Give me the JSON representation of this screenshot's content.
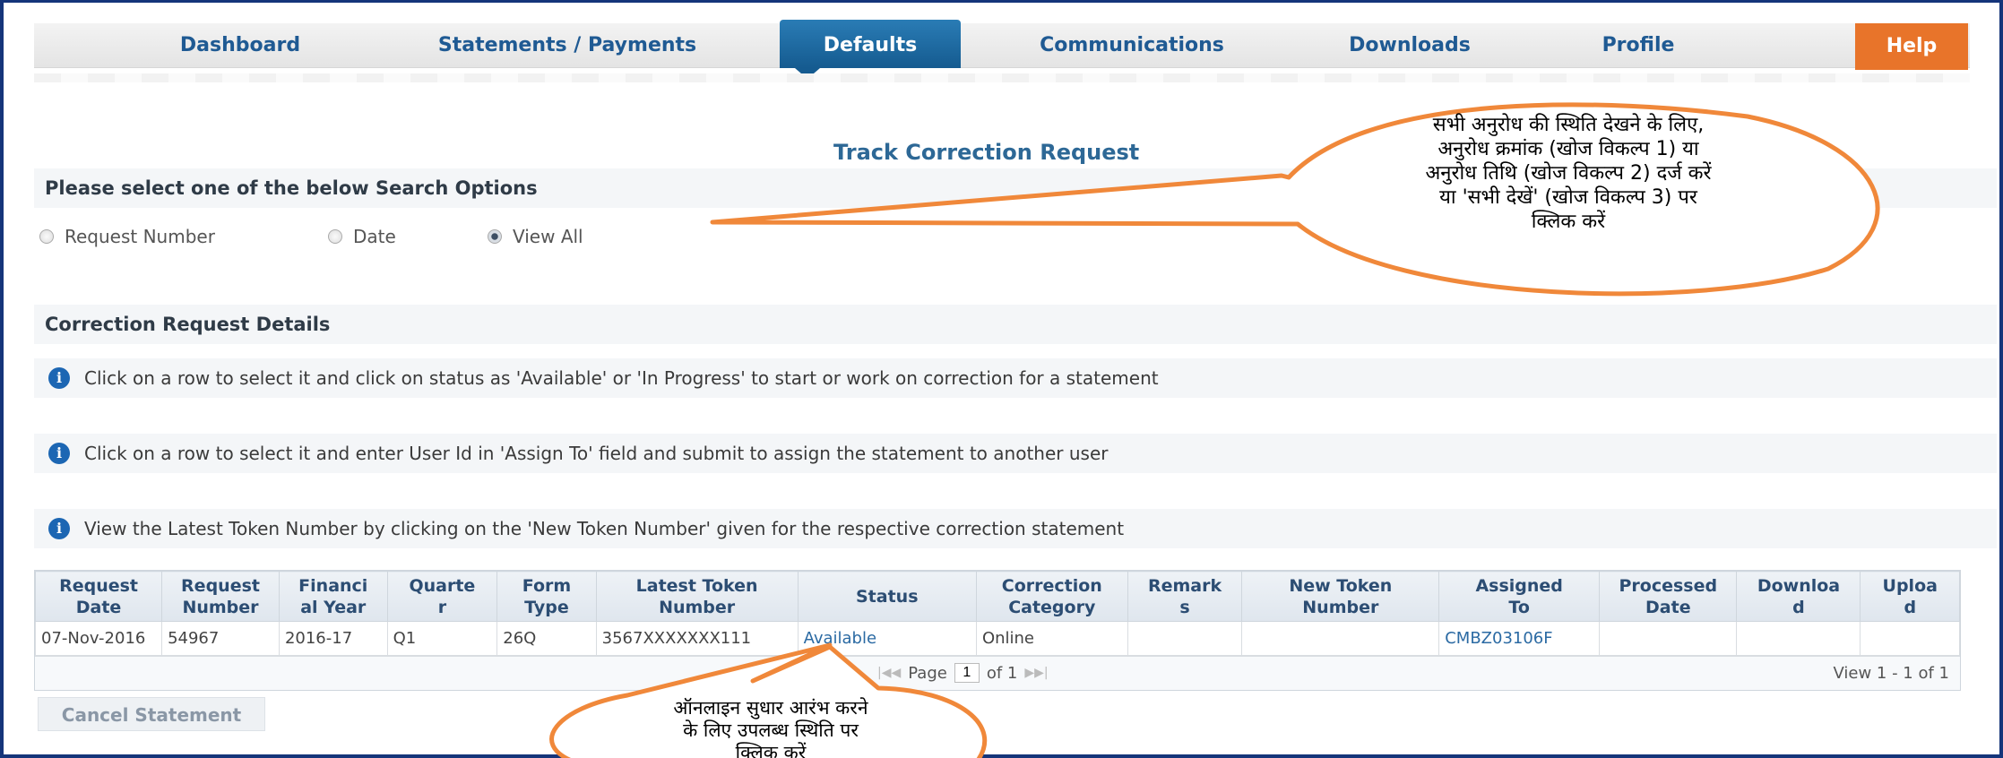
{
  "nav": {
    "items": [
      "Dashboard",
      "Statements / Payments",
      "Defaults",
      "Communications",
      "Downloads",
      "Profile"
    ],
    "active": "Defaults",
    "help": "Help"
  },
  "page_title": "Track Correction Request",
  "search": {
    "heading": "Please select one of the below Search Options",
    "options": [
      "Request Number",
      "Date",
      "View All"
    ],
    "selected": "View All"
  },
  "details": {
    "heading": "Correction Request Details",
    "info": [
      "Click on a row to select it and click on status as 'Available' or 'In Progress' to start or work on correction for a statement",
      "Click on a row to select it and enter User Id in 'Assign To' field and submit to assign the statement to another user",
      "View the Latest Token Number by clicking on the 'New Token Number' given for the respective correction statement"
    ]
  },
  "table": {
    "headers": [
      "Request Date",
      "Request Number",
      "Financial Year",
      "Quarter",
      "Form Type",
      "Latest Token Number",
      "Status",
      "Correction Category",
      "Remarks",
      "New Token Number",
      "Assigned To",
      "Processed Date",
      "Download",
      "Upload"
    ],
    "header_lines": [
      [
        "Request",
        "Date"
      ],
      [
        "Request",
        "Number"
      ],
      [
        "Financi",
        "al Year"
      ],
      [
        "Quarte",
        "r"
      ],
      [
        "Form",
        "Type"
      ],
      [
        "Latest Token",
        "Number"
      ],
      [
        "Status"
      ],
      [
        "Correction",
        "Category"
      ],
      [
        "Remark",
        "s"
      ],
      [
        "New Token",
        "Number"
      ],
      [
        "Assigned",
        "To"
      ],
      [
        "Processed",
        "Date"
      ],
      [
        "Downloa",
        "d"
      ],
      [
        "Uploa",
        "d"
      ]
    ],
    "rows": [
      [
        "07-Nov-2016",
        "54967",
        "2016-17",
        "Q1",
        "26Q",
        "3567XXXXXXX111",
        "Available",
        "Online",
        "",
        "",
        "CMBZ03106F",
        "",
        "",
        ""
      ]
    ],
    "pager": {
      "page_label": "Page",
      "page": "1",
      "of_label": "of 1",
      "view": "View 1 - 1 of 1"
    }
  },
  "cancel_button": "Cancel Statement",
  "callouts": {
    "top": [
      "सभी अनुरोध की स्थिति देखने के लिए,",
      "अनुरोध क्रमांक (खोज विकल्प 1) या",
      "अनुरोध तिथि (खोज विकल्प 2) दर्ज करें",
      "या 'सभी देखें' (खोज विकल्प 3) पर",
      "क्लिक करें"
    ],
    "bottom": [
      "ऑनलाइन सुधार आरंभ करने",
      "के लिए उपलब्ध स्थिति पर",
      "क्लिक करें"
    ]
  },
  "colors": {
    "nav_active": "#155b90",
    "help": "#e8742a",
    "callout_border": "#f0883a",
    "frame": "#15357a",
    "link": "#2b6aa3"
  }
}
